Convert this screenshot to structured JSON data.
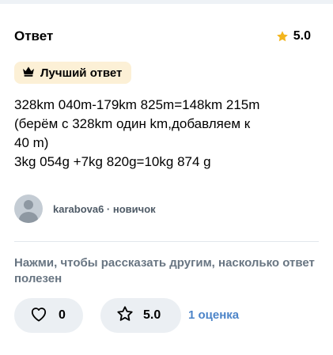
{
  "header": {
    "title": "Ответ",
    "rating": "5.0",
    "star_icon": "star-filled-icon",
    "star_color": "#f3b51d"
  },
  "badge": {
    "icon": "crown-icon",
    "label": "Лучший ответ",
    "background": "#fcf0d6"
  },
  "answer": {
    "lines": [
      "328km 040m-179km 825m=148km 215m",
      "(берём с 328km один km,добавляем к",
      "40 m)",
      "3kg 054g +7kg 820g=10kg 874 g"
    ]
  },
  "author": {
    "avatar_icon": "user-avatar-icon",
    "line": "karabova6 · новичок"
  },
  "feedback": {
    "prompt": "Нажми, чтобы рассказать другим, насколько ответ полезен",
    "like_icon": "heart-outline-icon",
    "likes": "0",
    "rate_icon": "star-outline-icon",
    "rate_value": "5.0",
    "rating_count": "1 оценка",
    "link_color": "#4c84c8"
  }
}
